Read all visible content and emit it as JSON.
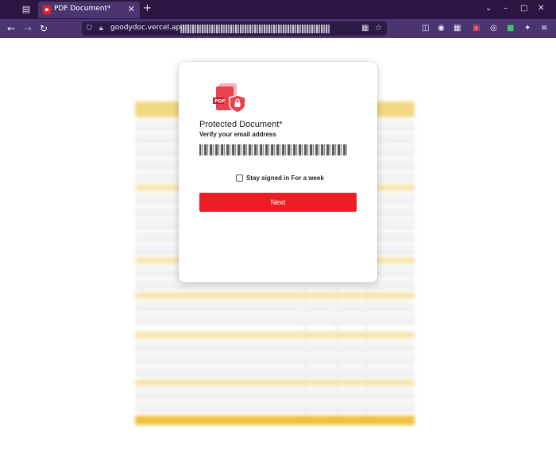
{
  "browser": {
    "tab": {
      "title": "PDF Document*"
    },
    "address_bar": {
      "url": "goodydoc.vercel.app/"
    }
  },
  "dialog": {
    "title": "Protected Document*",
    "subtitle": "Verify your email address",
    "remember_label": "Stay signed in For a week",
    "next_label": "Next",
    "icon": "pdf-lock-icon",
    "accent_color": "#ec1c24"
  }
}
